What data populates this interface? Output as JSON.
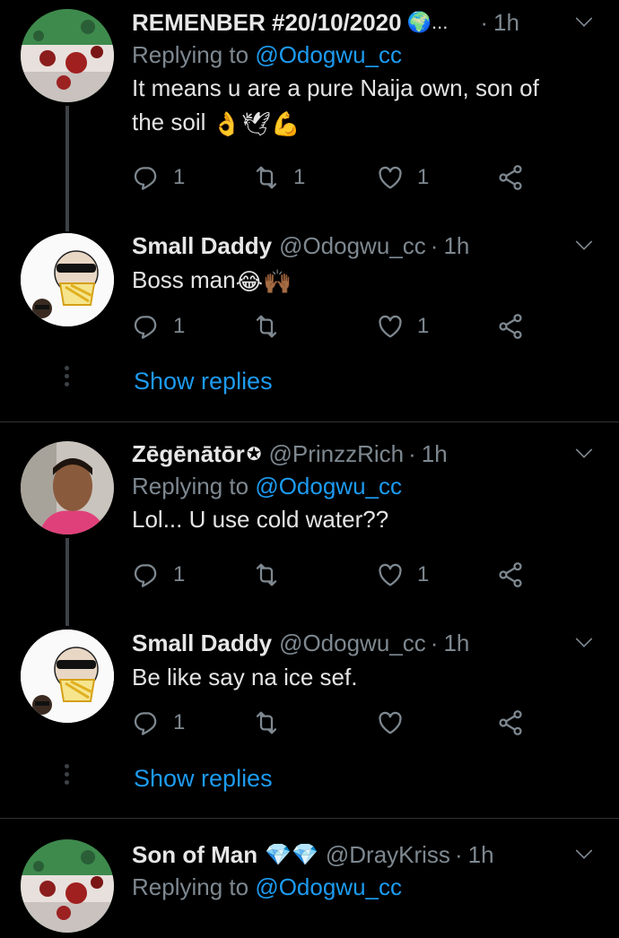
{
  "tweets": [
    {
      "name": "REMENBER #20/10/2020",
      "name_suffix": "🌍...",
      "handle": "",
      "time": "1h",
      "reply_prefix": "Replying to",
      "reply_to": "@Odogwu_cc",
      "text_line1": "It means u are a pure Naija own, son of",
      "text_line2": "the soil",
      "text_emoji": "👌🕊💪",
      "reply_count": "1",
      "retweet_count": "1",
      "like_count": "1"
    },
    {
      "name": "Small Daddy",
      "handle": "@Odogwu_cc",
      "time": "1h",
      "text_line1": "Boss man",
      "text_emoji": "😂🙌🏾",
      "reply_count": "1",
      "retweet_count": "",
      "like_count": "1"
    },
    {
      "name": "Zēgēnātōr",
      "name_suffix": "✪",
      "handle": "@PrinzzRich",
      "time": "1h",
      "reply_prefix": "Replying to",
      "reply_to": "@Odogwu_cc",
      "text_line1": "Lol... U use cold water??",
      "reply_count": "1",
      "retweet_count": "",
      "like_count": "1"
    },
    {
      "name": "Small Daddy",
      "handle": "@Odogwu_cc",
      "time": "1h",
      "text_line1": "Be like say na ice sef.",
      "reply_count": "1",
      "retweet_count": "",
      "like_count": ""
    },
    {
      "name": "Son of Man",
      "name_suffix": "💎💎",
      "handle": "@DrayKriss",
      "time": "1h",
      "reply_prefix": "Replying to",
      "reply_to": "@Odogwu_cc"
    }
  ],
  "show_replies_label": "Show replies",
  "dot_separator": "·",
  "colors": {
    "background": "#000000",
    "accent": "#1d9bf0",
    "muted": "#7e8890",
    "divider": "#2f3336"
  },
  "icons": {
    "reply": "reply-icon",
    "retweet": "retweet-icon",
    "like": "heart-icon",
    "share": "share-icon",
    "more": "chevron-down-icon"
  }
}
